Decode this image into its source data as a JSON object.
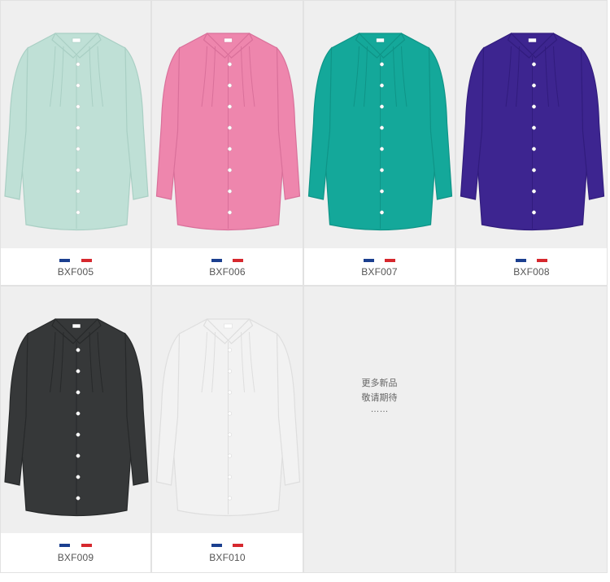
{
  "products": [
    {
      "code": "BXF005",
      "color": "#bfe0d6",
      "shade": "#a9cfc4"
    },
    {
      "code": "BXF006",
      "color": "#ee86ad",
      "shade": "#d9709a"
    },
    {
      "code": "BXF007",
      "color": "#14a89a",
      "shade": "#0f9487"
    },
    {
      "code": "BXF008",
      "color": "#3d2590",
      "shade": "#311c7d"
    },
    {
      "code": "BXF009",
      "color": "#363839",
      "shade": "#27292a"
    },
    {
      "code": "BXF010",
      "color": "#f2f2f2",
      "shade": "#dedede"
    }
  ],
  "flag_colors": [
    "#1b3f8f",
    "#ffffff",
    "#d6282e"
  ],
  "coming_soon": {
    "line1": "更多新品",
    "line2": "敬请期待",
    "line3": "……"
  },
  "background": "#efefef"
}
